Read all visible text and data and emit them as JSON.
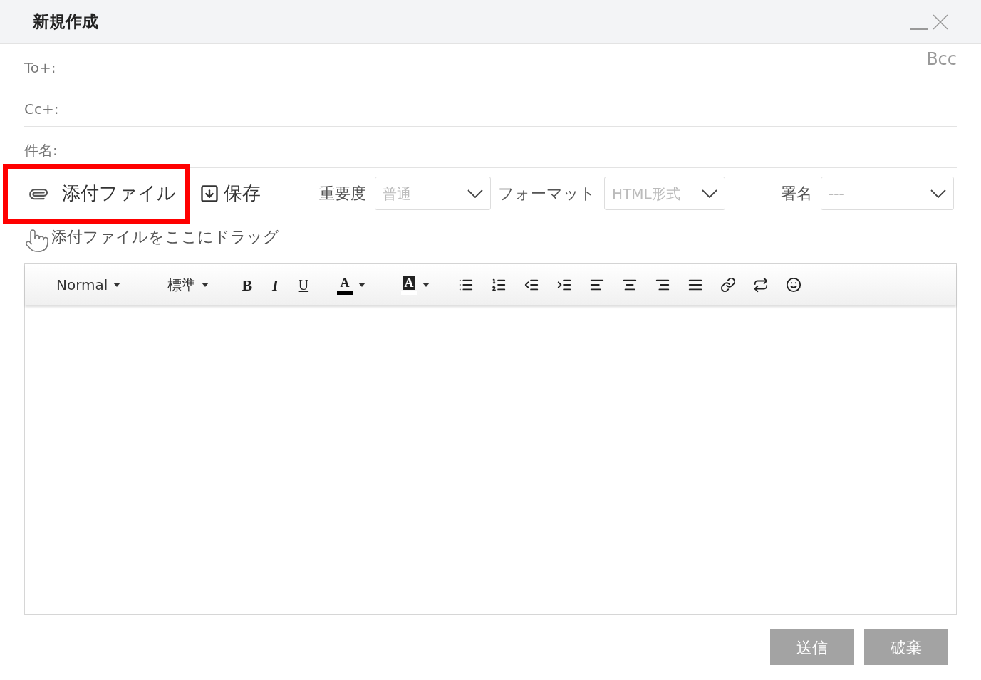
{
  "window": {
    "title": "新規作成"
  },
  "fields": [
    {
      "label": "To+:",
      "link": "Bcc"
    },
    {
      "label": "Cc+:"
    },
    {
      "label": "件名:"
    }
  ],
  "toolbar": {
    "attach": "添付ファイル",
    "attach_highlighted": true,
    "save": "保存",
    "selects": [
      {
        "label": "重要度",
        "value": "普通"
      },
      {
        "label": "フォーマット",
        "value": "HTML形式"
      },
      {
        "label": "署名",
        "value": "---"
      }
    ]
  },
  "drop_hint": "添付ファイルをここにドラッグ",
  "editor_toolbar": [
    {
      "kind": "dropdown",
      "label": "Normal"
    },
    {
      "kind": "dropdown",
      "label": "標準"
    },
    {
      "kind": "bold",
      "label": "B"
    },
    {
      "kind": "italic",
      "label": "I"
    },
    {
      "kind": "underline",
      "label": "U"
    },
    {
      "kind": "color",
      "label": "A",
      "color": "#000000"
    },
    {
      "kind": "background",
      "label": "A",
      "color": "#ffffff"
    }
  ],
  "buttons": [
    "送信",
    "破棄"
  ]
}
